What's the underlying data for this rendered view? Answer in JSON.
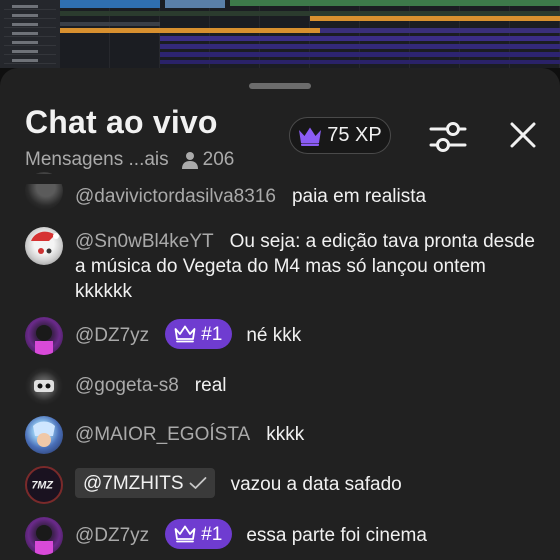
{
  "header": {
    "title": "Chat ao vivo",
    "mode_label": "Mensagens ...ais",
    "viewer_count": "206",
    "xp_label": "75 XP"
  },
  "colors": {
    "sheet_bg": "#212121",
    "badge_purple": "#6f3cd0",
    "author_gray": "#aaaaaa",
    "text_white": "#f1f1f1"
  },
  "icons": {
    "xp": "crown-icon",
    "viewers": "person-icon",
    "filter": "sliders-icon",
    "close": "close-icon",
    "rank": "crown-icon",
    "verified": "checkmark-icon"
  },
  "messages": [
    {
      "author": "@davivictordasilva8316",
      "text": "paia em realista"
    },
    {
      "author": "@Sn0wBl4keYT",
      "text": "Ou seja: a edição tava pronta desde a música do Vegeta do M4 mas só lançou ontem kkkkkk"
    },
    {
      "author": "@DZ7yz",
      "badge": "#1",
      "text": "né kkk"
    },
    {
      "author": "@gogeta-s8",
      "text": "real"
    },
    {
      "author": "@MAIOR_EGOÍSTA",
      "text": "kkkk"
    },
    {
      "author": "@7MZHITS",
      "verified": true,
      "text": "vazou a data safado"
    },
    {
      "author": "@DZ7yz",
      "badge": "#1",
      "text": "essa parte foi cinema"
    }
  ]
}
